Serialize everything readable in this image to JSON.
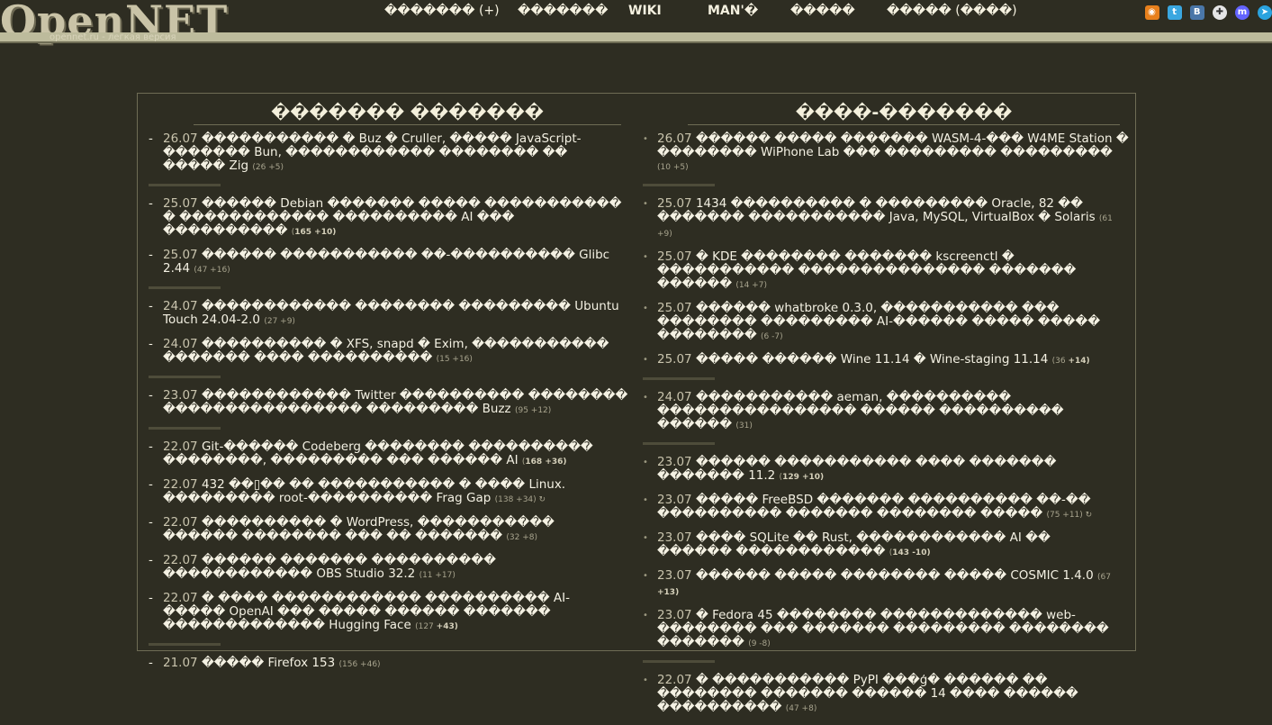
{
  "header": {
    "logo": "OpenNET",
    "logo_sub": "opennet.ru - легкая версия",
    "nav": [
      {
        "label": "������� (+)"
      },
      {
        "label": "�������"
      },
      {
        "label": "WIKI"
      },
      {
        "label": "MAN'�"
      },
      {
        "label": "�����"
      },
      {
        "label": "����� (����)"
      }
    ],
    "social_icons": [
      "rss-icon",
      "twitter-icon",
      "vk-icon",
      "livejournal-icon",
      "mastodon-icon",
      "telegram-icon"
    ]
  },
  "left": {
    "title": "������� �������",
    "items": [
      {
        "date": "26.07",
        "title": "����������� � Buz � Cruller, ����� JavaScript-������� Bun, ������������ �������� �� ����� Zig",
        "cnt": "(26 +5)",
        "cnt_bold": ""
      },
      {
        "sep": true
      },
      {
        "date": "25.07",
        "title": "������ Debian ������� ����� ����������� � ������������ ���������� AI ��� ����������",
        "cnt": "(",
        "cnt_bold": "165 +10)"
      },
      {
        "date": "25.07",
        "title": "������ ����������� ��-���������� Glibc 2.44",
        "cnt": "(47 +16)",
        "cnt_bold": ""
      },
      {
        "sep": true
      },
      {
        "date": "24.07",
        "title": "������������ �������� ��������� Ubuntu Touch 24.04-2.0",
        "cnt": "(27 +9)",
        "cnt_bold": ""
      },
      {
        "date": "24.07",
        "title": "���������� � XFS, snapd � Exim, ����������� ������� ���� ����������",
        "cnt": "(15 +16)",
        "cnt_bold": ""
      },
      {
        "sep": true
      },
      {
        "date": "23.07",
        "title": "������������ Twitter ���������� �������� ���������������� ��������� Buzz",
        "cnt": "(95 +12)",
        "cnt_bold": ""
      },
      {
        "sep": true
      },
      {
        "date": "22.07",
        "title": "Git-������ Codeberg �������� ���������� ��������, ��������� ��� ������ AI",
        "cnt": "(",
        "cnt_bold": "168 +36)"
      },
      {
        "date": "22.07",
        "title": "432 ��▯�� �� ����������� � ���� Linux. ��������� root-���������� Frag Gap",
        "cnt": "(138 +34) ↻",
        "cnt_bold": ""
      },
      {
        "date": "22.07",
        "title": "���������� � WordPress, ����������� ������ �������� ��� �� �������",
        "cnt": "(32 +8)",
        "cnt_bold": ""
      },
      {
        "date": "22.07",
        "title": "������ ������� ���������� ������������ OBS Studio 32.2",
        "cnt": "(11 +17)",
        "cnt_bold": ""
      },
      {
        "date": "22.07",
        "title": "� ���� ������������ ���������� AI-����� OpenAI ��� ����� ������ ������� ������������� Hugging Face",
        "cnt": "(127 ",
        "cnt_bold": "+43)"
      },
      {
        "sep": true
      },
      {
        "date": "21.07",
        "title": "����� Firefox 153",
        "cnt": "(156 +46)",
        "cnt_bold": ""
      }
    ]
  },
  "right": {
    "title": "����-�������",
    "items": [
      {
        "date": "26.07",
        "title": "������ ����� ������� WASM-4-��� W4ME Station � �������� WiPhone Lab ��� ��������� ���������",
        "cnt": "(10 +5)",
        "cnt_bold": ""
      },
      {
        "sep": true
      },
      {
        "date": "25.07",
        "title": "1434 ���������� � ��������� Oracle, 82 �� ������� ����������� Java, MySQL, VirtualBox � Solaris",
        "cnt": "(61 +9)",
        "cnt_bold": ""
      },
      {
        "date": "25.07",
        "title": "� KDE �������� ������� kscreenctl � ����������� ��������������� ������� ������",
        "cnt": "(14 +7)",
        "cnt_bold": ""
      },
      {
        "date": "25.07",
        "title": "������ whatbroke 0.3.0, ����������� ��� �������� ��������� AI-������ ����� ����� ��������",
        "cnt": "(6 -7)",
        "cnt_bold": ""
      },
      {
        "date": "25.07",
        "title": "����� ������ Wine 11.14 � Wine-staging 11.14",
        "cnt": "(36 ",
        "cnt_bold": "+14)"
      },
      {
        "sep": true
      },
      {
        "date": "24.07",
        "title": "����������� aeman, ���������� ���������������� ������ ���������� ������",
        "cnt": "(31)",
        "cnt_bold": ""
      },
      {
        "sep": true
      },
      {
        "date": "23.07",
        "title": "������ ����������� ���� ������� ������� 11.2",
        "cnt": "(",
        "cnt_bold": "129 +10)"
      },
      {
        "date": "23.07",
        "title": "����� FreeBSD ������� ���������� ��-�� ���������� ������� �������� �����",
        "cnt": "(75 +11) ↻",
        "cnt_bold": ""
      },
      {
        "date": "23.07",
        "title": "���� SQLite �� Rust, ������������ AI �� ������ ������������",
        "cnt": "(",
        "cnt_bold": "143 -10)"
      },
      {
        "date": "23.07",
        "title": "������ ����� �������� ����� COSMIC 1.4.0",
        "cnt": "(67 ",
        "cnt_bold": "+13)"
      },
      {
        "date": "23.07",
        "title": "� Fedora 45 �������� ������������� web-�������� ��� ������� ��������� �������� �������",
        "cnt": "(9 -8)",
        "cnt_bold": ""
      },
      {
        "sep": true
      },
      {
        "date": "22.07",
        "title": "� ����������� PyPI ���ģ� ������ �� �������� ������� ������ 14 ���� ������ ����������",
        "cnt": "(47 +8)",
        "cnt_bold": ""
      }
    ]
  }
}
